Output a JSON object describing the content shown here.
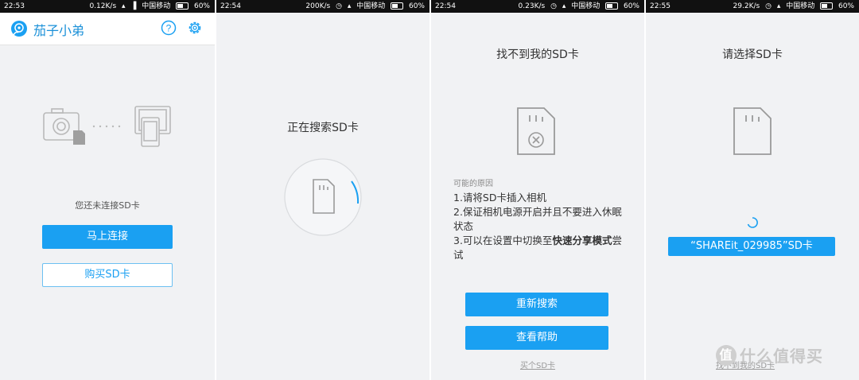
{
  "panels": [
    {
      "status": {
        "time": "22:53",
        "speed": "0.12K/s",
        "carrier": "中国移动",
        "battery": "60%"
      },
      "app_title": "茄子小弟",
      "message": "您还未连接SD卡",
      "connect_label": "马上连接",
      "buy_label": "购买SD卡"
    },
    {
      "status": {
        "time": "22:54",
        "speed": "200K/s",
        "carrier": "中国移动",
        "battery": "60%"
      },
      "title": "正在搜索SD卡"
    },
    {
      "status": {
        "time": "22:54",
        "speed": "0.23K/s",
        "carrier": "中国移动",
        "battery": "60%"
      },
      "title": "找不到我的SD卡",
      "reasons_heading": "可能的原因",
      "reason1": "1.请将SD卡插入相机",
      "reason2": "2.保证相机电源开启并且不要进入休眠状态",
      "reason3_prefix": "3.可以在设置中切换至",
      "reason3_bold": "快速分享模式",
      "reason3_suffix": "尝试",
      "research_label": "重新搜索",
      "help_label": "查看帮助",
      "buy_link": "买个SD卡"
    },
    {
      "status": {
        "time": "22:55",
        "speed": "29.2K/s",
        "carrier": "中国移动",
        "battery": "60%"
      },
      "title": "请选择SD卡",
      "card_label": "“SHAREit_029985”SD卡",
      "notfound_link": "找不到我的SD卡"
    }
  ],
  "watermark": {
    "badge": "值",
    "text": "什么值得买"
  },
  "colors": {
    "accent": "#1aa0f2",
    "background": "#f1f2f4",
    "statusbar": "#111111"
  }
}
